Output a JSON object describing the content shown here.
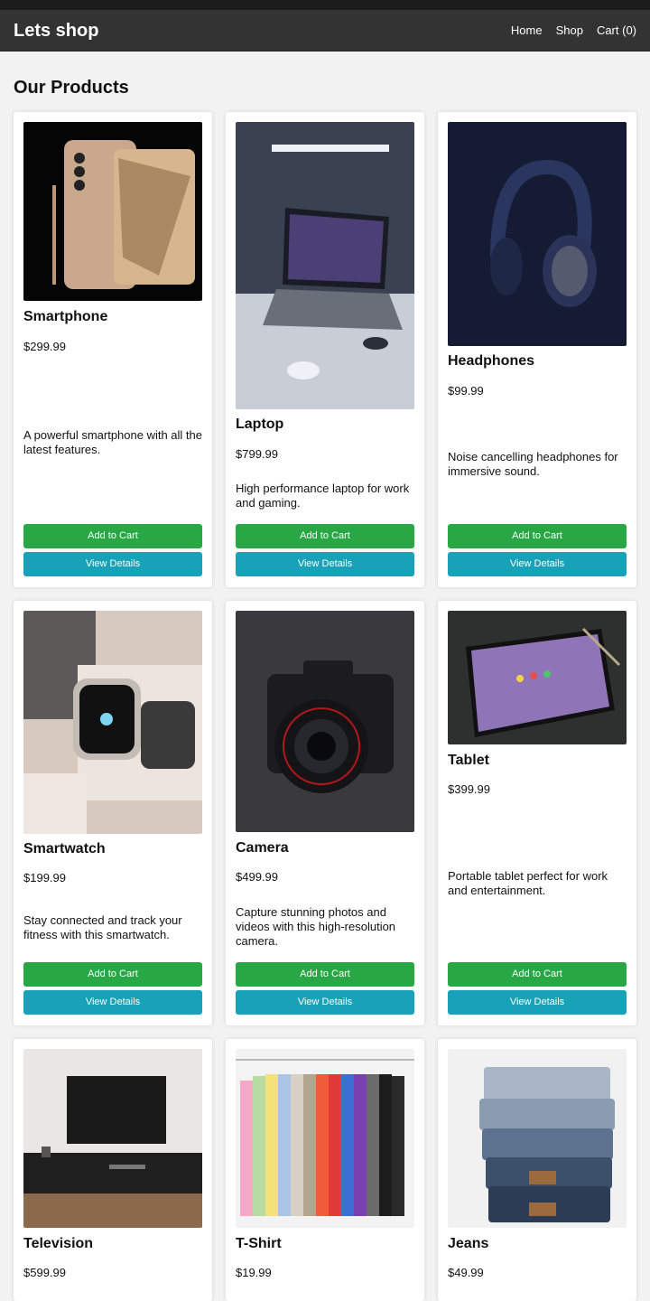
{
  "header": {
    "brand": "Lets shop",
    "nav": {
      "home": "Home",
      "shop": "Shop",
      "cart": "Cart (0)"
    }
  },
  "main": {
    "title": "Our Products",
    "products": [
      {
        "name": "Smartphone",
        "price": "$299.99",
        "description": "A powerful smartphone with all the latest features.",
        "add_label": "Add to Cart",
        "view_label": "View Details",
        "image": "smartphone-image"
      },
      {
        "name": "Laptop",
        "price": "$799.99",
        "description": "High performance laptop for work and gaming.",
        "add_label": "Add to Cart",
        "view_label": "View Details",
        "image": "laptop-image"
      },
      {
        "name": "Headphones",
        "price": "$99.99",
        "description": "Noise cancelling headphones for immersive sound.",
        "add_label": "Add to Cart",
        "view_label": "View Details",
        "image": "headphones-image"
      },
      {
        "name": "Smartwatch",
        "price": "$199.99",
        "description": "Stay connected and track your fitness with this smartwatch.",
        "add_label": "Add to Cart",
        "view_label": "View Details",
        "image": "smartwatch-image"
      },
      {
        "name": "Camera",
        "price": "$499.99",
        "description": "Capture stunning photos and videos with this high-resolution camera.",
        "add_label": "Add to Cart",
        "view_label": "View Details",
        "image": "camera-image"
      },
      {
        "name": "Tablet",
        "price": "$399.99",
        "description": "Portable tablet perfect for work and entertainment.",
        "add_label": "Add to Cart",
        "view_label": "View Details",
        "image": "tablet-image"
      },
      {
        "name": "Television",
        "price": "$599.99",
        "image": "television-image"
      },
      {
        "name": "T-Shirt",
        "price": "$19.99",
        "image": "tshirt-image"
      },
      {
        "name": "Jeans",
        "price": "$49.99",
        "image": "jeans-image"
      }
    ]
  },
  "colors": {
    "navbar": "#333333",
    "add_button": "#28a745",
    "view_button": "#17a2b8",
    "page_bg": "#f2f2f2"
  }
}
